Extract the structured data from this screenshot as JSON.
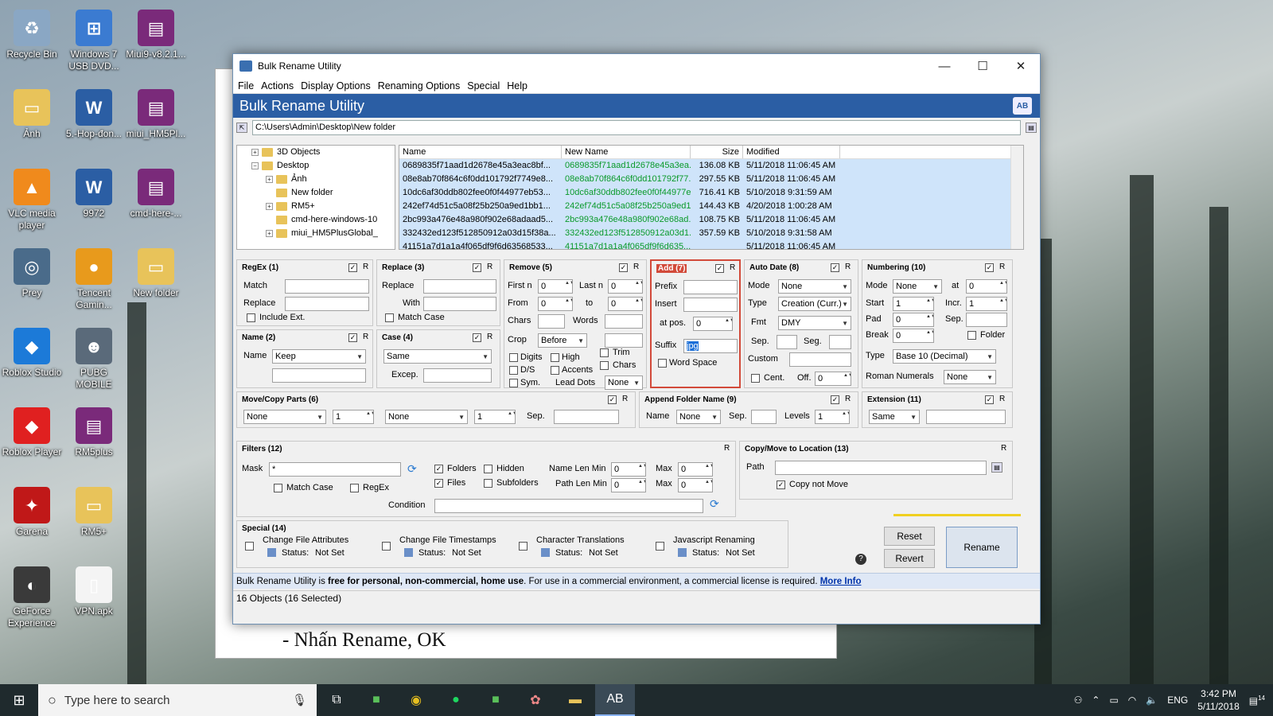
{
  "desktop_icons": [
    {
      "label": "Recycle Bin",
      "color": "#8aa7c4",
      "glyph": "♻"
    },
    {
      "label": "Windows 7 USB DVD...",
      "color": "#3b7bd1",
      "glyph": "⊞"
    },
    {
      "label": "Miui9-v8.2.1...",
      "color": "#7a2a7a",
      "glyph": "▤"
    },
    {
      "label": "Ảnh",
      "color": "#e8c35a",
      "glyph": "▭"
    },
    {
      "label": "5.-Hop-đon...",
      "color": "#2b5ea4",
      "glyph": "W"
    },
    {
      "label": "miui_HM5Pl...",
      "color": "#7a2a7a",
      "glyph": "▤"
    },
    {
      "label": "VLC media player",
      "color": "#f08a1c",
      "glyph": "▲"
    },
    {
      "label": "9972",
      "color": "#2b5ea4",
      "glyph": "W"
    },
    {
      "label": "cmd-here-...",
      "color": "#7a2a7a",
      "glyph": "▤"
    },
    {
      "label": "Prey",
      "color": "#4a6b8a",
      "glyph": "◎"
    },
    {
      "label": "Tencent Gamin...",
      "color": "#e89a1c",
      "glyph": "●"
    },
    {
      "label": "New folder",
      "color": "#e8c35a",
      "glyph": "▭"
    },
    {
      "label": "Roblox Studio",
      "color": "#1c7ad8",
      "glyph": "◆"
    },
    {
      "label": "PUBG MOBILE",
      "color": "#5a6a7a",
      "glyph": "☻"
    },
    {
      "label": "Roblox Player",
      "color": "#e02020",
      "glyph": "◆"
    },
    {
      "label": "RM5plus",
      "color": "#7a2a7a",
      "glyph": "▤"
    },
    {
      "label": "Garena",
      "color": "#c01818",
      "glyph": "✦"
    },
    {
      "label": "RM5+",
      "color": "#e8c35a",
      "glyph": "▭"
    },
    {
      "label": "GeForce Experience",
      "color": "#3a3a3a",
      "glyph": "◐"
    },
    {
      "label": "VPN.apk",
      "color": "#f4f4f4",
      "glyph": "▯"
    }
  ],
  "bgdoc": {
    "line": "- Nhấn Rename, OK"
  },
  "window": {
    "title": "Bulk Rename Utility",
    "menu": [
      "File",
      "Actions",
      "Display Options",
      "Renaming Options",
      "Special",
      "Help"
    ],
    "banner": "Bulk Rename Utility",
    "path": "C:\\Users\\Admin\\Desktop\\New folder",
    "controls": {
      "minimize": "—",
      "maximize": "☐",
      "close": "✕"
    }
  },
  "tree": [
    {
      "label": "3D Objects",
      "indent": 1,
      "pm": "+"
    },
    {
      "label": "Desktop",
      "indent": 1,
      "pm": "−"
    },
    {
      "label": "Ảnh",
      "indent": 2,
      "pm": "+"
    },
    {
      "label": "New folder",
      "indent": 2,
      "pm": ""
    },
    {
      "label": "RM5+",
      "indent": 2,
      "pm": "+"
    },
    {
      "label": "cmd-here-windows-10",
      "indent": 2,
      "pm": ""
    },
    {
      "label": "miui_HM5PlusGlobal_",
      "indent": 2,
      "pm": "+"
    }
  ],
  "files": {
    "columns": [
      "Name",
      "New Name",
      "Size",
      "Modified"
    ],
    "rows": [
      [
        "0689835f71aad1d2678e45a3eac8bf...",
        "0689835f71aad1d2678e45a3ea...",
        "136.08 KB",
        "5/11/2018 11:06:45 AM"
      ],
      [
        "08e8ab70f864c6f0dd101792f7749e8...",
        "08e8ab70f864c6f0dd101792f77...",
        "297.55 KB",
        "5/11/2018 11:06:45 AM"
      ],
      [
        "10dc6af30ddb802fee0f0f44977eb53...",
        "10dc6af30ddb802fee0f0f44977e...",
        "716.41 KB",
        "5/10/2018 9:31:59 AM"
      ],
      [
        "242ef74d51c5a08f25b250a9ed1bb1...",
        "242ef74d51c5a08f25b250a9ed1...",
        "144.43 KB",
        "4/20/2018 1:00:28 AM"
      ],
      [
        "2bc993a476e48a980f902e68adaad5...",
        "2bc993a476e48a980f902e68ad...",
        "108.75 KB",
        "5/11/2018 11:06:45 AM"
      ],
      [
        "332432ed123f512850912a03d15f38a...",
        "332432ed123f512850912a03d1...",
        "357.59 KB",
        "5/10/2018 9:31:58 AM"
      ],
      [
        "41151a7d1a1a4f065df9f6d63568533...",
        "41151a7d1a1a4f065df9f6d635...",
        "",
        "5/11/2018 11:06:45 AM"
      ]
    ]
  },
  "panels": {
    "regex": {
      "title": "RegEx (1)",
      "match": "Match",
      "replace": "Replace",
      "include_ext": "Include Ext."
    },
    "replace": {
      "title": "Replace (3)",
      "replace": "Replace",
      "with": "With",
      "match_case": "Match Case"
    },
    "remove": {
      "title": "Remove (5)",
      "first_n": "First n",
      "last_n": "Last n",
      "from": "From",
      "to": "to",
      "chars": "Chars",
      "words": "Words",
      "crop": "Crop",
      "crop_val": "Before",
      "digits": "Digits",
      "high": "High",
      "ds": "D/S",
      "accents": "Accents",
      "sym": "Sym.",
      "lead_dots": "Lead Dots",
      "lead_val": "None",
      "trim": "Trim",
      "chars2": "Chars",
      "zero": "0"
    },
    "add": {
      "title": "Add (7)",
      "prefix": "Prefix",
      "insert": "Insert",
      "atpos": "at pos.",
      "atpos_val": "0",
      "suffix": "Suffix",
      "suffix_val": "jpg",
      "word_space": "Word Space"
    },
    "autodate": {
      "title": "Auto Date (8)",
      "mode": "Mode",
      "mode_val": "None",
      "type": "Type",
      "type_val": "Creation (Curr.)",
      "fmt": "Fmt",
      "fmt_val": "DMY",
      "sep": "Sep.",
      "seg": "Seg.",
      "custom": "Custom",
      "cent": "Cent.",
      "off": "Off.",
      "off_val": "0"
    },
    "numbering": {
      "title": "Numbering (10)",
      "mode": "Mode",
      "mode_val": "None",
      "at": "at",
      "at_val": "0",
      "start": "Start",
      "start_val": "1",
      "incr": "Incr.",
      "incr_val": "1",
      "pad": "Pad",
      "pad_val": "0",
      "sep": "Sep.",
      "brk": "Break",
      "brk_val": "0",
      "folder": "Folder",
      "type": "Type",
      "type_val": "Base 10 (Decimal)",
      "roman": "Roman Numerals",
      "roman_val": "None"
    },
    "name": {
      "title": "Name (2)",
      "name": "Name",
      "name_val": "Keep"
    },
    "case": {
      "title": "Case (4)",
      "case_val": "Same",
      "excep": "Excep."
    },
    "movecopy": {
      "title": "Move/Copy Parts (6)",
      "v1": "None",
      "n1": "1",
      "v2": "None",
      "n2": "1",
      "sep": "Sep."
    },
    "appendfolder": {
      "title": "Append Folder Name (9)",
      "name": "Name",
      "name_val": "None",
      "sep": "Sep.",
      "levels": "Levels",
      "levels_val": "1"
    },
    "extension": {
      "title": "Extension (11)",
      "val": "Same"
    },
    "filters": {
      "title": "Filters (12)",
      "mask": "Mask",
      "mask_val": "*",
      "folders": "Folders",
      "hidden": "Hidden",
      "files": "Files",
      "subfolders": "Subfolders",
      "name_len_min": "Name Len Min",
      "path_len_min": "Path Len Min",
      "max": "Max",
      "zero": "0",
      "match_case": "Match Case",
      "regex": "RegEx",
      "condition": "Condition"
    },
    "copymove": {
      "title": "Copy/Move to Location (13)",
      "path": "Path",
      "copy_not_move": "Copy not Move"
    },
    "special": {
      "title": "Special (14)",
      "items": [
        {
          "label": "Change File Attributes",
          "status": "Status:",
          "status_val": "Not Set"
        },
        {
          "label": "Change File Timestamps",
          "status": "Status:",
          "status_val": "Not Set"
        },
        {
          "label": "Character Translations",
          "status": "Status:",
          "status_val": "Not Set"
        },
        {
          "label": "Javascript Renaming",
          "status": "Status:",
          "status_val": "Not Set"
        }
      ]
    }
  },
  "common": {
    "r": "R",
    "check": "✓"
  },
  "buttons": {
    "reset": "Reset",
    "revert": "Revert",
    "rename": "Rename",
    "help": "?"
  },
  "license": {
    "pre": "Bulk Rename Utility is ",
    "bold": "free for personal, non-commercial, home use",
    "post": ". For use in a commercial environment, a commercial license is required. ",
    "link": "More Info"
  },
  "statusbar": "16 Objects (16 Selected)",
  "taskbar": {
    "search_placeholder": "Type here to search",
    "lang": "ENG",
    "time": "3:42 PM",
    "date": "5/11/2018",
    "notif": "14"
  }
}
